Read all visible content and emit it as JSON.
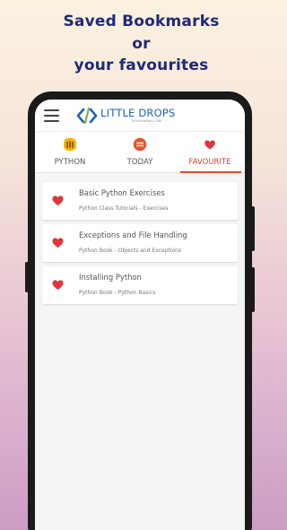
{
  "promo": {
    "line1": "Saved Bookmarks",
    "line2": "or",
    "line3": "your favourites"
  },
  "app": {
    "logo_text": "LITTLE DROPS",
    "logo_subtext": "THYAGARAAJ.COM"
  },
  "tabs": [
    {
      "label": "PYTHON",
      "icon": "python-icon",
      "active": false
    },
    {
      "label": "TODAY",
      "icon": "today-icon",
      "active": false
    },
    {
      "label": "FAVOURITE",
      "icon": "heart-icon",
      "active": true
    }
  ],
  "bookmarks": [
    {
      "title": "Basic Python Exercises",
      "subtitle": "Python Class Tutorials - Exercises",
      "icon": "heart-icon"
    },
    {
      "title": "Exceptions and File Handling",
      "subtitle": "Python Book - Objects and Exceptions",
      "icon": "heart-icon"
    },
    {
      "title": "Installing Python",
      "subtitle": "Python Book - Python Basics",
      "icon": "heart-icon"
    }
  ],
  "colors": {
    "accent": "#e24a31",
    "heart": "#e0363b",
    "promo_text": "#1e2a78",
    "logo": "#1f64b6"
  }
}
